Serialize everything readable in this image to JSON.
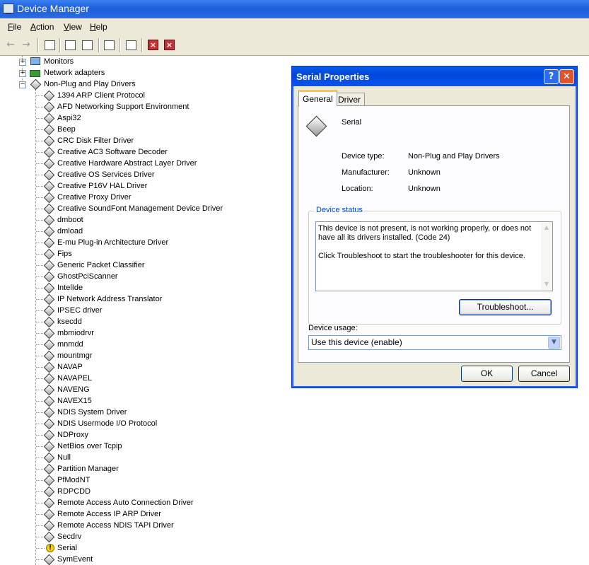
{
  "window": {
    "title": "Device Manager"
  },
  "menu": {
    "file": "File",
    "action": "Action",
    "view": "View",
    "help": "Help"
  },
  "tree": {
    "monitors": "Monitors",
    "network_adapters": "Network adapters",
    "non_pnp": "Non-Plug and Play Drivers",
    "items": [
      "1394 ARP Client Protocol",
      "AFD Networking Support Environment",
      "Aspi32",
      "Beep",
      "CRC Disk Filter Driver",
      "Creative AC3 Software Decoder",
      "Creative Hardware Abstract Layer Driver",
      "Creative OS Services Driver",
      "Creative P16V HAL Driver",
      "Creative Proxy Driver",
      "Creative SoundFont Management Device Driver",
      "dmboot",
      "dmload",
      "E-mu Plug-in Architecture Driver",
      "Fips",
      "Generic Packet Classifier",
      "GhostPciScanner",
      "IntelIde",
      "IP Network Address Translator",
      "IPSEC driver",
      "ksecdd",
      "mbmiodrvr",
      "mnmdd",
      "mountmgr",
      "NAVAP",
      "NAVAPEL",
      "NAVENG",
      "NAVEX15",
      "NDIS System Driver",
      "NDIS Usermode I/O Protocol",
      "NDProxy",
      "NetBios over Tcpip",
      "Null",
      "Partition Manager",
      "PfModNT",
      "RDPCDD",
      "Remote Access Auto Connection Driver",
      "Remote Access IP ARP Driver",
      "Remote Access NDIS TAPI Driver",
      "Secdrv",
      "Serial",
      "SymEvent"
    ],
    "warning_item": "Serial"
  },
  "dialog": {
    "title": "Serial Properties",
    "help_glyph": "?",
    "close_glyph": "✕",
    "tabs": [
      "General",
      "Driver"
    ],
    "device_name": "Serial",
    "device_type_label": "Device type:",
    "device_type_value": "Non-Plug and Play Drivers",
    "manufacturer_label": "Manufacturer:",
    "manufacturer_value": "Unknown",
    "location_label": "Location:",
    "location_value": "Unknown",
    "status_group": "Device status",
    "status_text": "This device is not present, is not working properly, or does not have all its drivers installed. (Code 24)\n\nClick Troubleshoot to start the troubleshooter for this device.",
    "troubleshoot_label": "Troubleshoot...",
    "usage_label": "Device usage:",
    "usage_value": "Use this device (enable)",
    "ok_label": "OK",
    "cancel_label": "Cancel"
  }
}
